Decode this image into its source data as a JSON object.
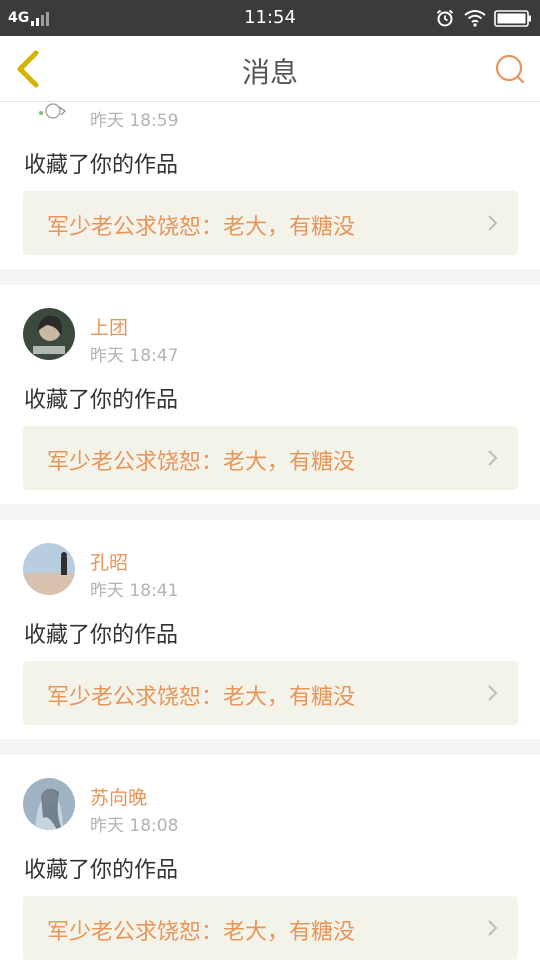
{
  "status_bar": {
    "network": "4G",
    "time": "11:54",
    "icons": [
      "signal-icon",
      "alarm-icon",
      "wifi-icon",
      "battery-icon"
    ]
  },
  "nav": {
    "title": "消息",
    "back_icon": "chevron-left-icon",
    "search_icon": "search-icon"
  },
  "colors": {
    "accent": "#e8955a",
    "back_arrow": "#d4b400",
    "link_background": "#f3f3ea",
    "status_bar": "#3b3b3b"
  },
  "messages": [
    {
      "user": "",
      "time": "昨天 18:59",
      "action": "收藏了你的作品",
      "work": "军少老公求饶恕：老大，有糖没"
    },
    {
      "user": "上团",
      "time": "昨天 18:47",
      "action": "收藏了你的作品",
      "work": "军少老公求饶恕：老大，有糖没"
    },
    {
      "user": "孔昭",
      "time": "昨天 18:41",
      "action": "收藏了你的作品",
      "work": "军少老公求饶恕：老大，有糖没"
    },
    {
      "user": "苏向晚",
      "time": "昨天 18:08",
      "action": "收藏了你的作品",
      "work": "军少老公求饶恕：老大，有糖没"
    }
  ]
}
